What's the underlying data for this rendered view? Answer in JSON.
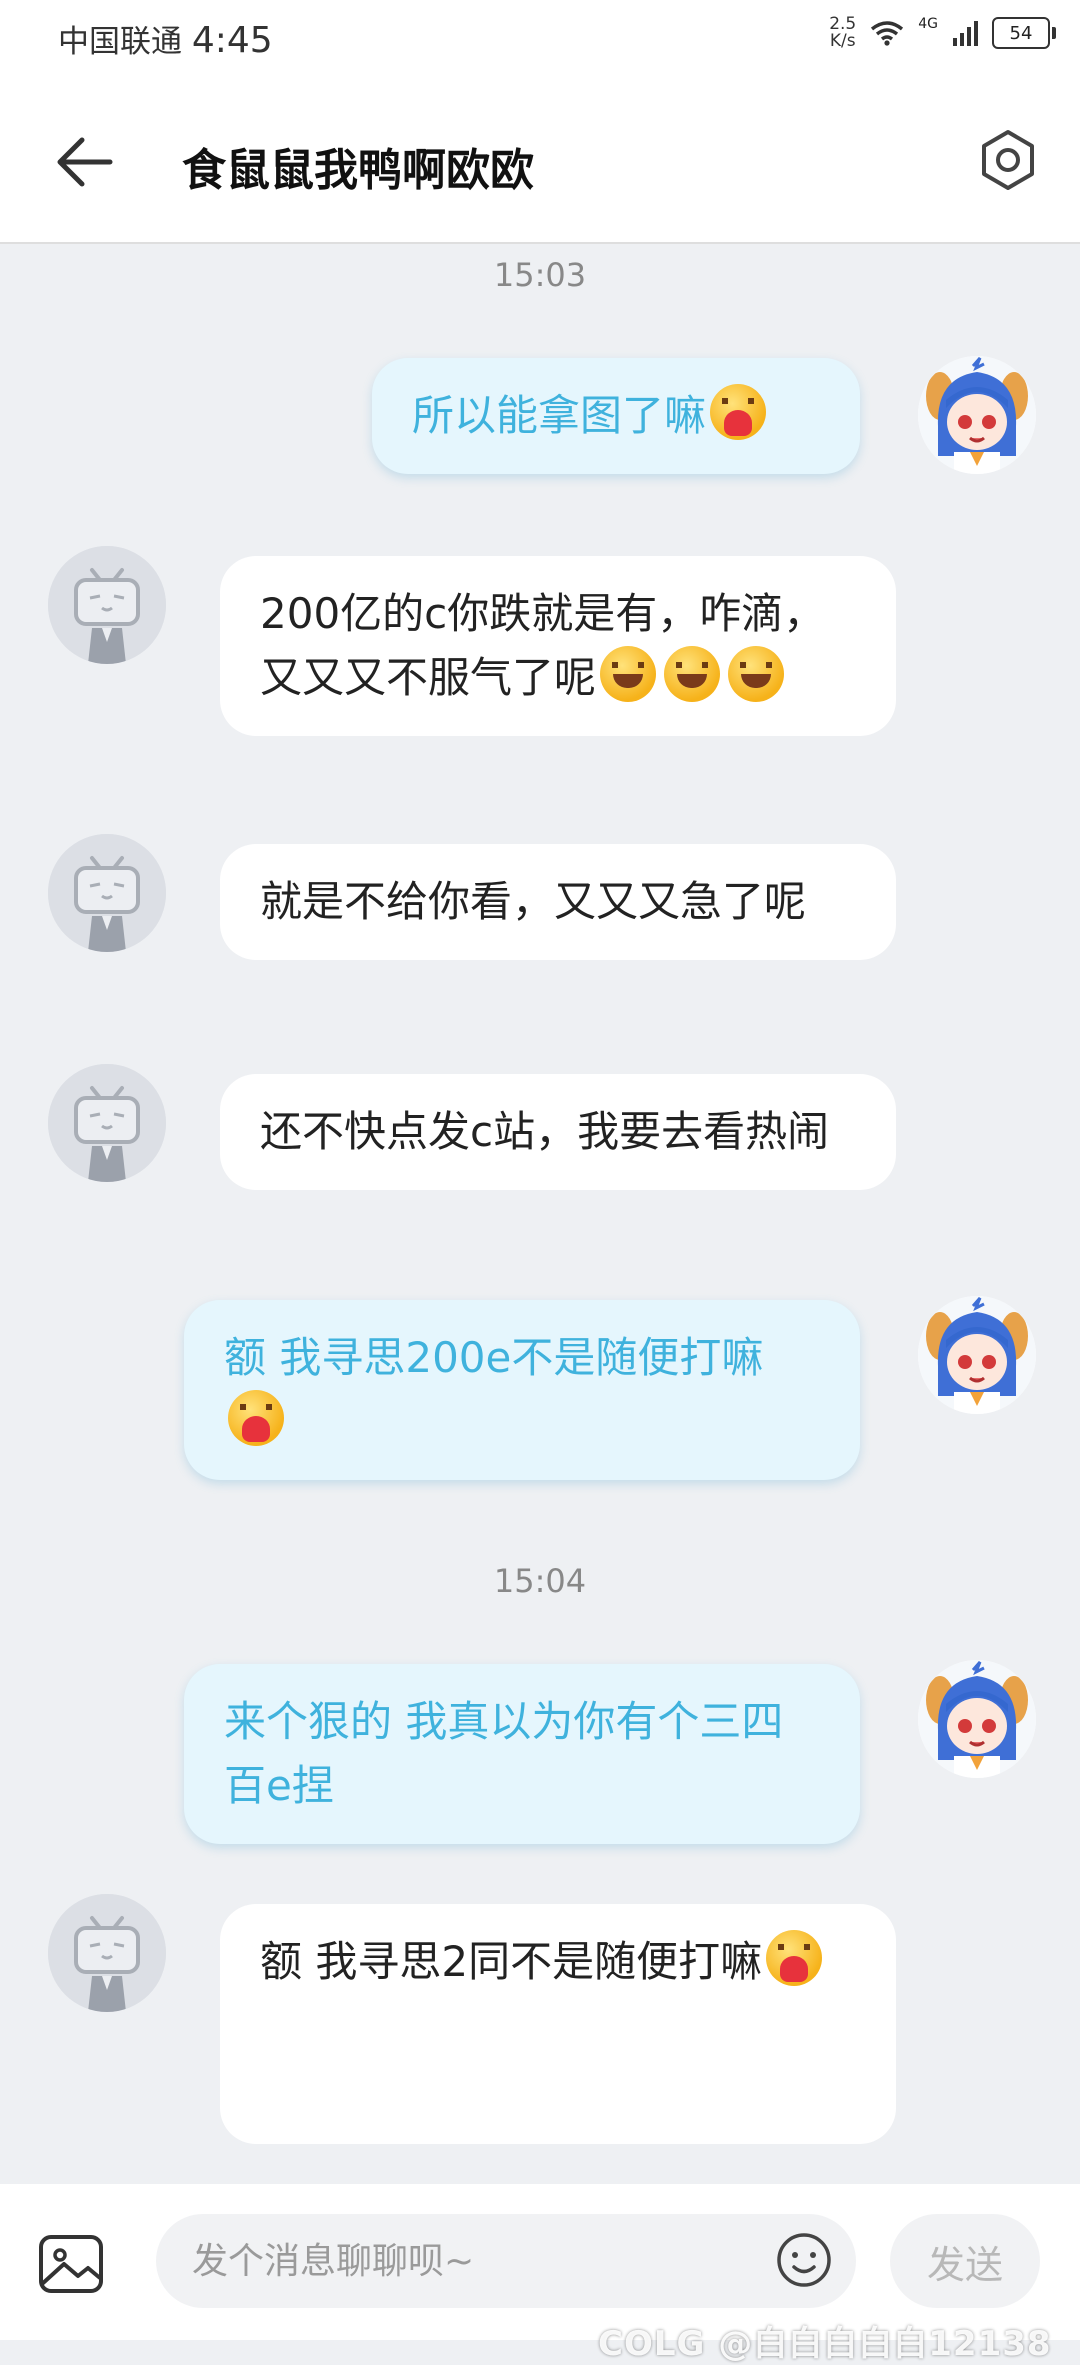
{
  "status_bar": {
    "carrier": "中国联通",
    "time": "4:45",
    "net_speed_value": "2.5",
    "net_speed_unit": "K/s",
    "network": "4G",
    "battery": "54"
  },
  "header": {
    "title": "食鼠鼠我鸭啊欧欧"
  },
  "messages": [
    {
      "kind": "time",
      "text": "15:03"
    },
    {
      "kind": "out",
      "text": "所以能拿图了嘛",
      "emojis": [
        "hug"
      ]
    },
    {
      "kind": "in",
      "text": "200亿的c你跌就是有，咋滴，又又又不服气了呢",
      "emojis": [
        "laugh",
        "laugh",
        "laugh"
      ]
    },
    {
      "kind": "in",
      "text": "就是不给你看，又又又急了呢"
    },
    {
      "kind": "in",
      "text": "还不快点发c站，我要去看热闹"
    },
    {
      "kind": "out",
      "text": "额 我寻思200e不是随便打嘛",
      "emojis": [
        "hug"
      ]
    },
    {
      "kind": "time",
      "text": "15:04"
    },
    {
      "kind": "out",
      "text": "来个狠的 我真以为你有个三四百e捏"
    },
    {
      "kind": "in",
      "text": "额 我寻思2同不是随便打嘛",
      "emojis": [
        "hug"
      ]
    }
  ],
  "input": {
    "placeholder": "发个消息聊聊呗~",
    "value": ""
  },
  "send_label": "发送",
  "watermark": "COLG @白白白白白12138",
  "colors": {
    "outgoing_bubble": "#e5f6fd",
    "outgoing_text": "#3fb2dd",
    "incoming_bubble": "#ffffff",
    "chat_background": "#eef0f3"
  }
}
